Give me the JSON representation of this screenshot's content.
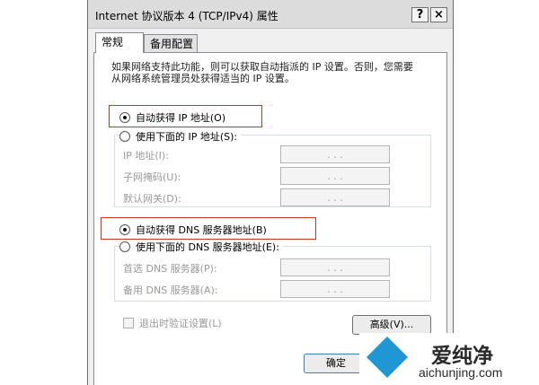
{
  "window": {
    "title": "Internet 协议版本 4 (TCP/IPv4) 属性",
    "help_label": "?",
    "close_label": "×"
  },
  "tabs": [
    {
      "label": "常规",
      "active": true
    },
    {
      "label": "备用配置",
      "active": false
    }
  ],
  "description": "如果网络支持此功能，则可以获取自动指派的 IP 设置。否则，您需要从网络系统管理员处获得适当的 IP 设置。",
  "ip_section": {
    "auto_label": "自动获得 IP 地址(O)",
    "auto_checked": true,
    "manual_label": "使用下面的 IP 地址(S):",
    "manual_checked": false,
    "fields": [
      {
        "label": "IP 地址(I):",
        "value": ". . ."
      },
      {
        "label": "子网掩码(U):",
        "value": ". . ."
      },
      {
        "label": "默认网关(D):",
        "value": ". . ."
      }
    ]
  },
  "dns_section": {
    "auto_label": "自动获得 DNS 服务器地址(B)",
    "auto_checked": true,
    "manual_label": "使用下面的 DNS 服务器地址(E):",
    "manual_checked": false,
    "fields": [
      {
        "label": "首选 DNS 服务器(P):",
        "value": ". . ."
      },
      {
        "label": "备用 DNS 服务器(A):",
        "value": ". . ."
      }
    ]
  },
  "validate_label": "退出时验证设置(L)",
  "advanced_label": "高级(V)...",
  "ok_label": "确定",
  "highlight_color": "#c0392b",
  "watermark": {
    "brand": "爱纯净",
    "url": "aichunjing.com"
  }
}
